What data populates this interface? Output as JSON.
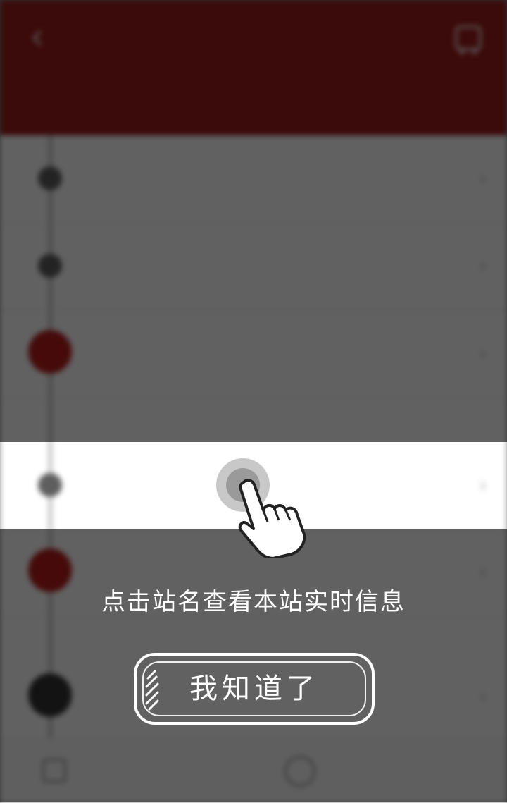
{
  "header": {
    "title": "",
    "route_line": "",
    "route_meta": ""
  },
  "stops": [
    {
      "name": "",
      "sub": "",
      "type": "normal"
    },
    {
      "name": "",
      "sub": "",
      "type": "normal"
    },
    {
      "name": "",
      "sub": "",
      "type": "bus"
    },
    {
      "name": "",
      "sub": "",
      "type": "highlight"
    },
    {
      "name": "",
      "sub": "",
      "type": "bus"
    },
    {
      "name": "",
      "sub": "",
      "type": "normal"
    }
  ],
  "bottom_bar": {
    "left_label": "",
    "right_label": ""
  },
  "guide": {
    "hint": "点击站名查看本站实时信息",
    "button_label": "我知道了"
  },
  "icons": {
    "back": "back-arrow-icon",
    "bus": "bus-icon",
    "hand": "tap-hand-icon"
  },
  "colors": {
    "brand": "#9b1c1c",
    "overlay": "rgba(0,0,0,0.62)",
    "highlight_row": "#ffffff"
  }
}
